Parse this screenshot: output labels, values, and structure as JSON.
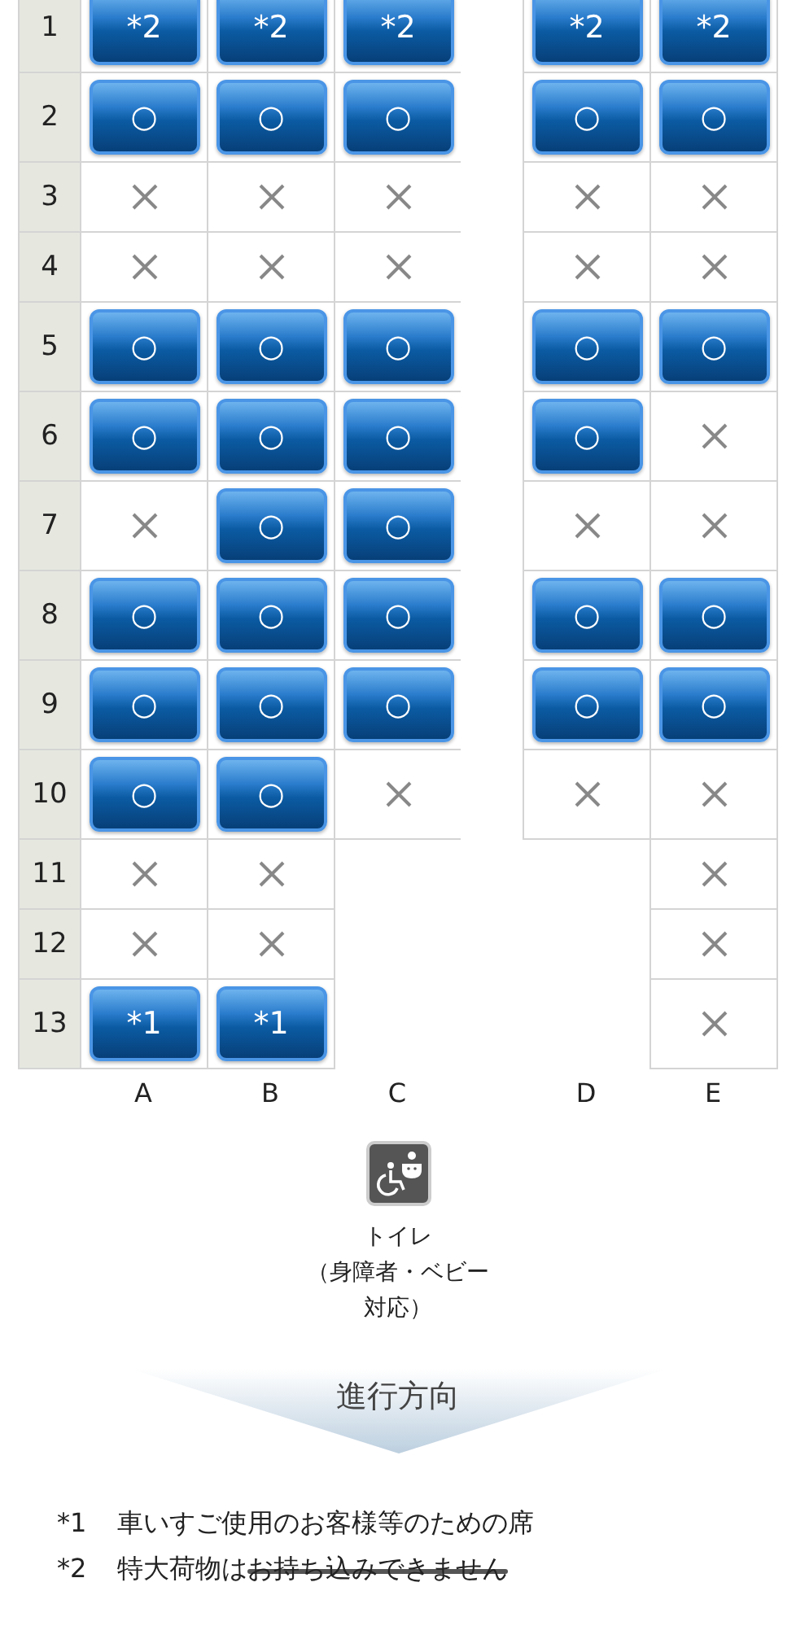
{
  "seat_map": {
    "columns": [
      "A",
      "B",
      "C",
      "D",
      "E"
    ],
    "rows": [
      {
        "number": "1",
        "seats": [
          {
            "kind": "seat",
            "label": "*2"
          },
          {
            "kind": "seat",
            "label": "*2"
          },
          {
            "kind": "seat",
            "label": "*2"
          },
          {
            "kind": "seat",
            "label": "*2"
          },
          {
            "kind": "seat",
            "label": "*2"
          }
        ]
      },
      {
        "number": "2",
        "seats": [
          {
            "kind": "seat",
            "label": "○"
          },
          {
            "kind": "seat",
            "label": "○"
          },
          {
            "kind": "seat",
            "label": "○"
          },
          {
            "kind": "seat",
            "label": "○"
          },
          {
            "kind": "seat",
            "label": "○"
          }
        ]
      },
      {
        "number": "3",
        "seats": [
          {
            "kind": "taken"
          },
          {
            "kind": "taken"
          },
          {
            "kind": "taken"
          },
          {
            "kind": "taken"
          },
          {
            "kind": "taken"
          }
        ]
      },
      {
        "number": "4",
        "seats": [
          {
            "kind": "taken"
          },
          {
            "kind": "taken"
          },
          {
            "kind": "taken"
          },
          {
            "kind": "taken"
          },
          {
            "kind": "taken"
          }
        ]
      },
      {
        "number": "5",
        "seats": [
          {
            "kind": "seat",
            "label": "○"
          },
          {
            "kind": "seat",
            "label": "○"
          },
          {
            "kind": "seat",
            "label": "○"
          },
          {
            "kind": "seat",
            "label": "○"
          },
          {
            "kind": "seat",
            "label": "○"
          }
        ]
      },
      {
        "number": "6",
        "seats": [
          {
            "kind": "seat",
            "label": "○"
          },
          {
            "kind": "seat",
            "label": "○"
          },
          {
            "kind": "seat",
            "label": "○"
          },
          {
            "kind": "seat",
            "label": "○"
          },
          {
            "kind": "taken"
          }
        ]
      },
      {
        "number": "7",
        "seats": [
          {
            "kind": "taken"
          },
          {
            "kind": "seat",
            "label": "○"
          },
          {
            "kind": "seat",
            "label": "○"
          },
          {
            "kind": "taken"
          },
          {
            "kind": "taken"
          }
        ]
      },
      {
        "number": "8",
        "seats": [
          {
            "kind": "seat",
            "label": "○"
          },
          {
            "kind": "seat",
            "label": "○"
          },
          {
            "kind": "seat",
            "label": "○"
          },
          {
            "kind": "seat",
            "label": "○"
          },
          {
            "kind": "seat",
            "label": "○"
          }
        ]
      },
      {
        "number": "9",
        "seats": [
          {
            "kind": "seat",
            "label": "○"
          },
          {
            "kind": "seat",
            "label": "○"
          },
          {
            "kind": "seat",
            "label": "○"
          },
          {
            "kind": "seat",
            "label": "○"
          },
          {
            "kind": "seat",
            "label": "○"
          }
        ]
      },
      {
        "number": "10",
        "seats": [
          {
            "kind": "seat",
            "label": "○"
          },
          {
            "kind": "seat",
            "label": "○"
          },
          {
            "kind": "taken"
          },
          {
            "kind": "taken"
          },
          {
            "kind": "taken"
          }
        ]
      },
      {
        "number": "11",
        "seats": [
          {
            "kind": "taken"
          },
          {
            "kind": "taken"
          },
          {
            "kind": "none"
          },
          {
            "kind": "none"
          },
          {
            "kind": "taken"
          }
        ]
      },
      {
        "number": "12",
        "seats": [
          {
            "kind": "taken"
          },
          {
            "kind": "taken"
          },
          {
            "kind": "none"
          },
          {
            "kind": "none"
          },
          {
            "kind": "taken"
          }
        ]
      },
      {
        "number": "13",
        "seats": [
          {
            "kind": "seat",
            "label": "*1"
          },
          {
            "kind": "seat",
            "label": "*1"
          },
          {
            "kind": "none"
          },
          {
            "kind": "none"
          },
          {
            "kind": "taken"
          }
        ]
      }
    ]
  },
  "toilet": {
    "lines": [
      "トイレ",
      "（身障者・ベビー",
      "対応）"
    ]
  },
  "direction": "進行方向",
  "notes": [
    {
      "mark": "*1",
      "text": "車いすご使用のお客様等のための席"
    },
    {
      "mark": "*2",
      "text": "特大荷物は",
      "struck_text": "お持ち込みできません"
    }
  ]
}
